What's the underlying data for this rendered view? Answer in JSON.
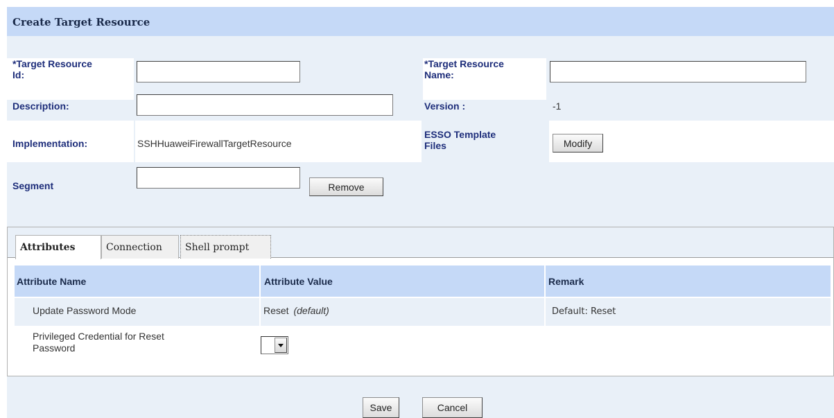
{
  "page": {
    "title": "Create Target Resource"
  },
  "form": {
    "target_resource_id": {
      "label_line1": "*Target Resource",
      "label_line2": "Id:",
      "value": ""
    },
    "target_resource_name": {
      "label_line1": "*Target Resource",
      "label_line2": "Name:",
      "value": ""
    },
    "description": {
      "label": "Description:",
      "value": ""
    },
    "version": {
      "label": "Version :",
      "value": "-1"
    },
    "implementation": {
      "label": "Implementation:",
      "value": "SSHHuaweiFirewallTargetResource"
    },
    "esso_template_files": {
      "label_line1": "ESSO Template",
      "label_line2": "Files",
      "button": "Modify"
    },
    "segment": {
      "label": "Segment",
      "value": "",
      "button": "Remove"
    }
  },
  "tabs": [
    {
      "label": "Attributes",
      "active": true
    },
    {
      "label": "Connection",
      "active": false
    },
    {
      "label": "Shell prompt",
      "active": false
    }
  ],
  "attributes_table": {
    "headers": [
      "Attribute Name",
      "Attribute Value",
      "Remark"
    ],
    "rows": [
      {
        "name": "Update Password Mode",
        "value": "Reset",
        "value_note": "(default)",
        "remark": "Default: Reset"
      },
      {
        "name_line1": "Privileged Credential for Reset",
        "name_line2": "Password",
        "value": "",
        "remark": ""
      }
    ]
  },
  "footer": {
    "save": "Save",
    "cancel": "Cancel"
  }
}
